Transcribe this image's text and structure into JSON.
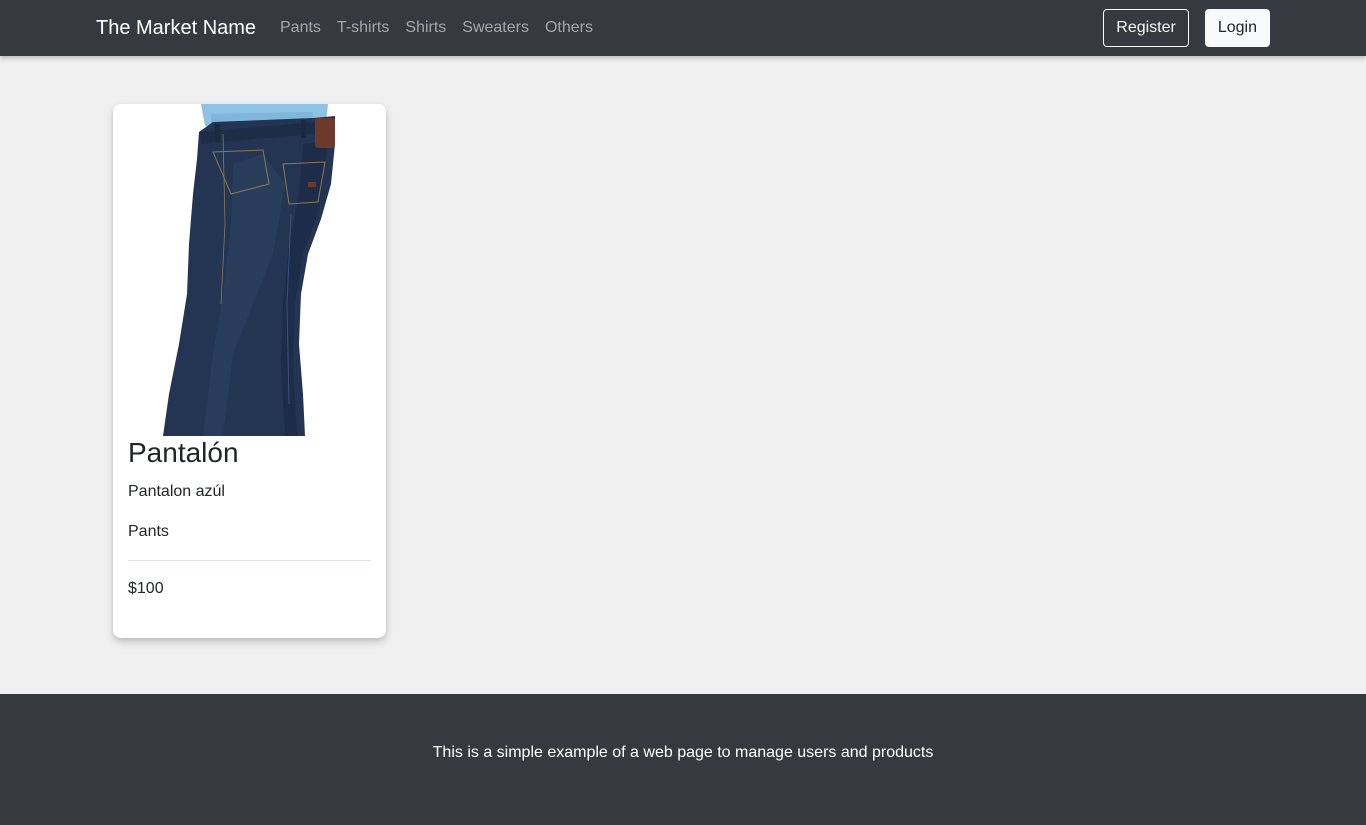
{
  "navbar": {
    "brand": "The Market Name",
    "links": [
      "Pants",
      "T-shirts",
      "Shirts",
      "Sweaters",
      "Others"
    ],
    "register_label": "Register",
    "login_label": "Login"
  },
  "products": [
    {
      "title": "Pantalón",
      "description": "Pantalon azúl",
      "category": "Pants",
      "price": "$100",
      "image_icon": "jeans-image"
    }
  ],
  "footer": {
    "text": "This is a simple example of a web page to manage users and products"
  },
  "colors": {
    "navbar_bg": "#343a40",
    "page_bg": "#f0f0f0",
    "denim": "#233552"
  }
}
